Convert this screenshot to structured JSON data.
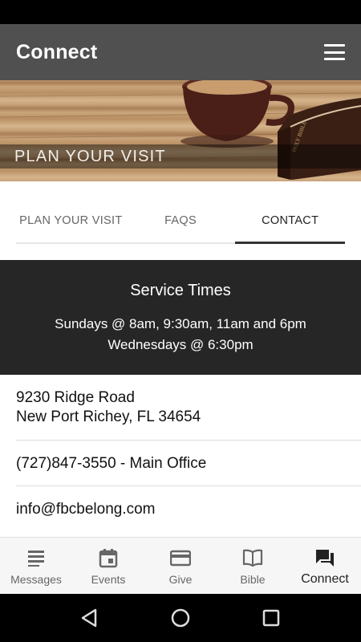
{
  "app_bar": {
    "title": "Connect"
  },
  "hero": {
    "label": "PLAN YOUR VISIT"
  },
  "tabs": [
    {
      "label": "PLAN YOUR VISIT"
    },
    {
      "label": "FAQS"
    },
    {
      "label": "CONTACT"
    }
  ],
  "service": {
    "title": "Service Times",
    "line1": "Sundays @ 8am, 9:30am, 11am and 6pm",
    "line2": "Wednesdays @ 6:30pm"
  },
  "contact": {
    "address_line1": "9230 Ridge Road",
    "address_line2": "New Port Richey, FL 34654",
    "phone": "(727)847-3550 - Main Office",
    "email": "info@fbcbelong.com"
  },
  "bottom_nav": [
    {
      "label": "Messages",
      "icon": "messages-icon"
    },
    {
      "label": "Events",
      "icon": "calendar-icon"
    },
    {
      "label": "Give",
      "icon": "card-icon"
    },
    {
      "label": "Bible",
      "icon": "book-icon"
    },
    {
      "label": "Connect",
      "icon": "chat-icon"
    }
  ],
  "colors": {
    "app_bar": "#505050",
    "service_box": "#262626",
    "active_tab_underline": "#333333"
  }
}
